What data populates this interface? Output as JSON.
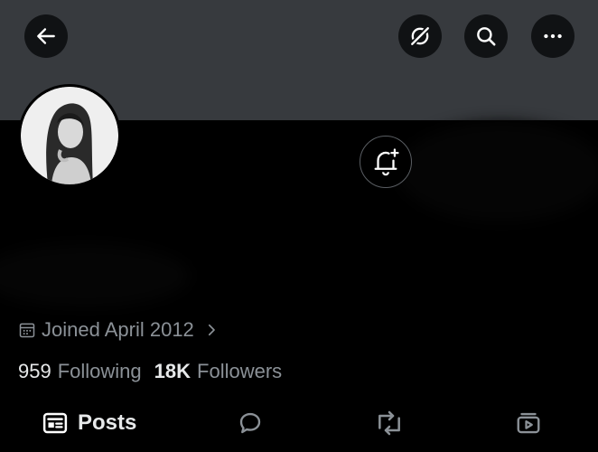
{
  "header": {
    "back_icon": "arrow-left-icon",
    "grok_icon": "grok-slash-icon",
    "search_icon": "search-icon",
    "more_icon": "more-horizontal-icon"
  },
  "profile": {
    "notify_icon": "bell-plus-icon",
    "joined_icon": "calendar-icon",
    "joined_text": "Joined April 2012",
    "following_count": "959",
    "following_label": "Following",
    "followers_count": "18K",
    "followers_label": "Followers"
  },
  "tabs": [
    {
      "label": "Posts",
      "icon": "posts-icon",
      "active": true
    },
    {
      "label": "",
      "icon": "reply-icon"
    },
    {
      "label": "",
      "icon": "repost-icon"
    },
    {
      "label": "",
      "icon": "media-icon"
    }
  ],
  "colors": {
    "banner": "#373a3e",
    "background": "#000000",
    "text": "#e7e9ea",
    "muted": "#8b9197"
  }
}
